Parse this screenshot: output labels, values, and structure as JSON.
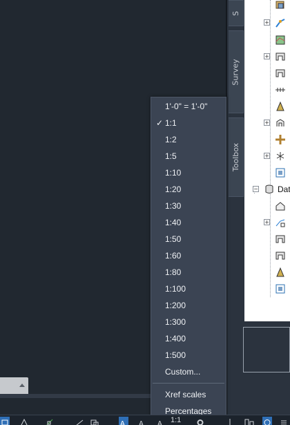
{
  "side_tabs": {
    "top": "S",
    "survey": "Survey",
    "toolbox": "Toolbox"
  },
  "tree": {
    "data_label": "Dat"
  },
  "scale_menu": {
    "items": [
      {
        "label": "1'-0\" = 1'-0\"",
        "checked": false
      },
      {
        "label": "1:1",
        "checked": true
      },
      {
        "label": "1:2",
        "checked": false
      },
      {
        "label": "1:5",
        "checked": false
      },
      {
        "label": "1:10",
        "checked": false
      },
      {
        "label": "1:20",
        "checked": false
      },
      {
        "label": "1:30",
        "checked": false
      },
      {
        "label": "1:40",
        "checked": false
      },
      {
        "label": "1:50",
        "checked": false
      },
      {
        "label": "1:60",
        "checked": false
      },
      {
        "label": "1:80",
        "checked": false
      },
      {
        "label": "1:100",
        "checked": false
      },
      {
        "label": "1:200",
        "checked": false
      },
      {
        "label": "1:300",
        "checked": false
      },
      {
        "label": "1:400",
        "checked": false
      },
      {
        "label": "1:500",
        "checked": false
      },
      {
        "label": "Custom...",
        "checked": false
      }
    ],
    "extra_items": [
      "Xref scales",
      "Percentages"
    ],
    "check_glyph": "✓"
  },
  "status_bar": {
    "scale_text": "1:1"
  },
  "colors": {
    "accent": "#2f6fb6",
    "menu_bg": "#3b4453",
    "canvas_bg": "#212830"
  }
}
